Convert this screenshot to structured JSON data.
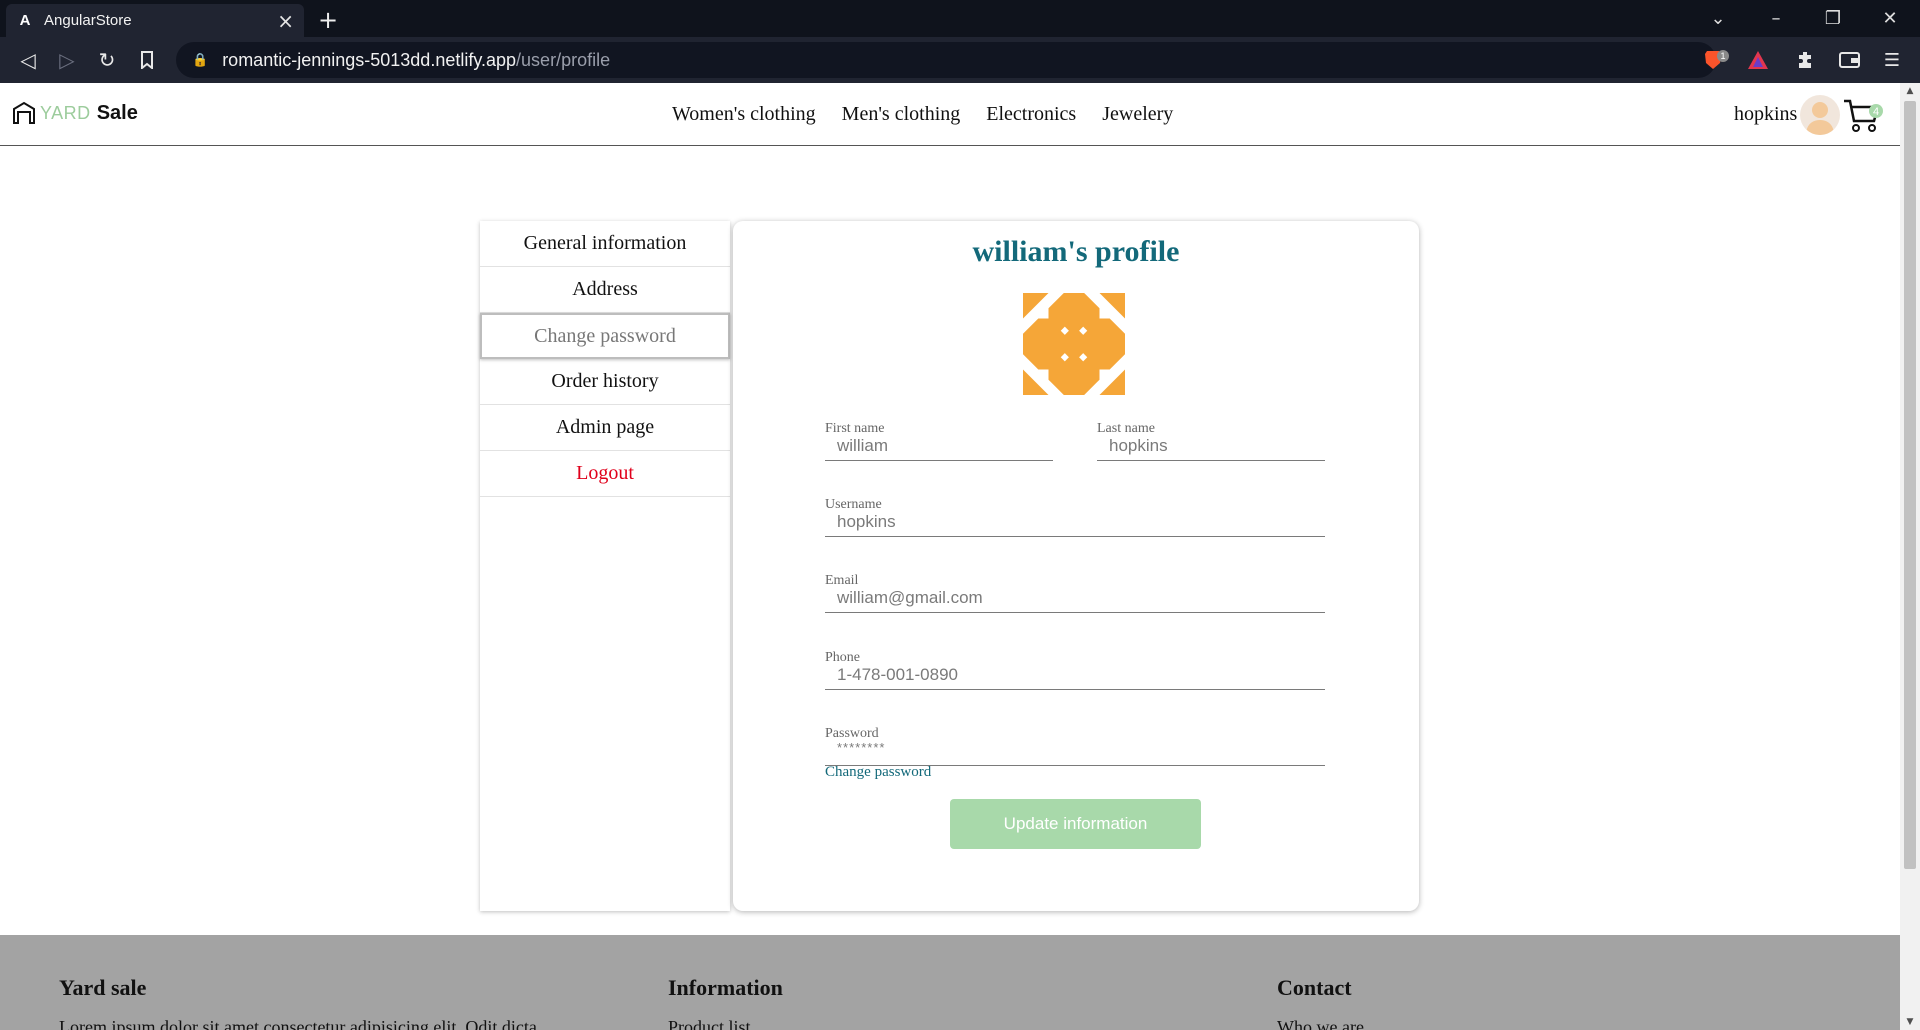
{
  "browser": {
    "tab_title": "AngularStore",
    "tab_favicon": "A",
    "url_host": "romantic-jennings-5013dd.netlify.app",
    "url_path": "/user/profile",
    "brave_badge": "1"
  },
  "header": {
    "logo_yard": "YARD",
    "logo_sale": "Sale",
    "nav": [
      "Women's clothing",
      "Men's clothing",
      "Electronics",
      "Jewelery"
    ],
    "username": "hopkins",
    "cart_count": "4"
  },
  "sidemenu": {
    "items": [
      "General information",
      "Address",
      "Change password",
      "Order history",
      "Admin page",
      "Logout"
    ],
    "active_index": 2
  },
  "profile": {
    "title": "william's profile",
    "first_name_label": "First name",
    "first_name": "william",
    "last_name_label": "Last name",
    "last_name": "hopkins",
    "username_label": "Username",
    "username": "hopkins",
    "email_label": "Email",
    "email": "william@gmail.com",
    "phone_label": "Phone",
    "phone": "1-478-001-0890",
    "password_label": "Password",
    "password": "********",
    "change_password_link": "Change password",
    "update_button": "Update information",
    "identicon_color": "#f5a638"
  },
  "footer": {
    "col1_title": "Yard sale",
    "col1_text": "Lorem ipsum dolor sit amet consectetur adipisicing elit. Odit dicta",
    "col2_title": "Information",
    "col2_text": "Product list",
    "col3_title": "Contact",
    "col3_text": "Who we are"
  },
  "colors": {
    "accent_teal": "#13697a",
    "button_green": "#a8d9aa",
    "logout_red": "#e0001b",
    "footer_gray": "#a3a3a3"
  }
}
